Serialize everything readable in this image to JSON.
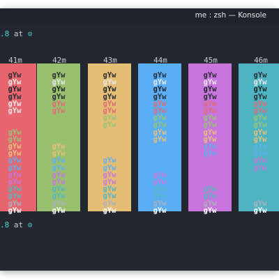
{
  "window": {
    "title": "me : zsh — Konsole"
  },
  "prompt_top": {
    "version": ".8",
    "at": " at ",
    "icon": "⊙"
  },
  "prompt_bottom": {
    "version": ".8",
    "at": " at ",
    "icon": "⊙"
  },
  "column_headers": [
    "41m",
    "42m",
    "43m",
    "44m",
    "45m",
    "46m"
  ],
  "column_backgrounds": [
    "#e6656e",
    "#98c06f",
    "#e5bd74",
    "#5aaef5",
    "#c775dc",
    "#4eb4c1"
  ],
  "sample_text": "gYw",
  "columns": [
    {
      "rows": [
        "#2b2f36",
        "#e7e7e7",
        "#1f232a",
        "#2b2f36",
        "#e7e7e7",
        "#e7e7e7",
        "",
        "",
        "#98c379",
        "#98c379",
        "#e5c07b",
        "#e5c07b",
        "#61afef",
        "#61afef",
        "#c678dd",
        "#c678dd",
        "#56b6c2",
        "#56b6c2",
        "#abb2bf",
        "#ffffff"
      ]
    },
    {
      "rows": [
        "#2b2f36",
        "#e7e7e7",
        "#1f232a",
        "#2b2f36",
        "#e06c75",
        "#e06c75",
        "",
        "",
        "",
        "",
        "#e5c07b",
        "#e5c07b",
        "#61afef",
        "#61afef",
        "#c678dd",
        "#c678dd",
        "#56b6c2",
        "#56b6c2",
        "#abb2bf",
        "#ffffff"
      ]
    },
    {
      "rows": [
        "#2b2f36",
        "#e7e7e7",
        "#1f232a",
        "#2b2f36",
        "#e06c75",
        "#e06c75",
        "#98c379",
        "#98c379",
        "",
        "",
        "",
        "",
        "#61afef",
        "#61afef",
        "#c678dd",
        "#c678dd",
        "#56b6c2",
        "#56b6c2",
        "#abb2bf",
        "#ffffff"
      ]
    },
    {
      "rows": [
        "#2b2f36",
        "#e7e7e7",
        "#1f232a",
        "#2b2f36",
        "#e06c75",
        "#e06c75",
        "#98c379",
        "#98c379",
        "#e5c07b",
        "#e5c07b",
        "",
        "",
        "",
        "",
        "#c678dd",
        "#c678dd",
        "#56b6c2",
        "#56b6c2",
        "#abb2bf",
        "#ffffff"
      ]
    },
    {
      "rows": [
        "#2b2f36",
        "#e7e7e7",
        "#1f232a",
        "#2b2f36",
        "#e06c75",
        "#e06c75",
        "#98c379",
        "#98c379",
        "#e5c07b",
        "#e5c07b",
        "#61afef",
        "#61afef",
        "",
        "",
        "",
        "",
        "#56b6c2",
        "#56b6c2",
        "#abb2bf",
        "#ffffff"
      ]
    },
    {
      "rows": [
        "#2b2f36",
        "#e7e7e7",
        "#1f232a",
        "#2b2f36",
        "#e06c75",
        "#e06c75",
        "#98c379",
        "#98c379",
        "#e5c07b",
        "#e5c07b",
        "#61afef",
        "#61afef",
        "#c678dd",
        "#c678dd",
        "",
        "",
        "",
        "",
        "#abb2bf",
        "#ffffff"
      ]
    }
  ]
}
